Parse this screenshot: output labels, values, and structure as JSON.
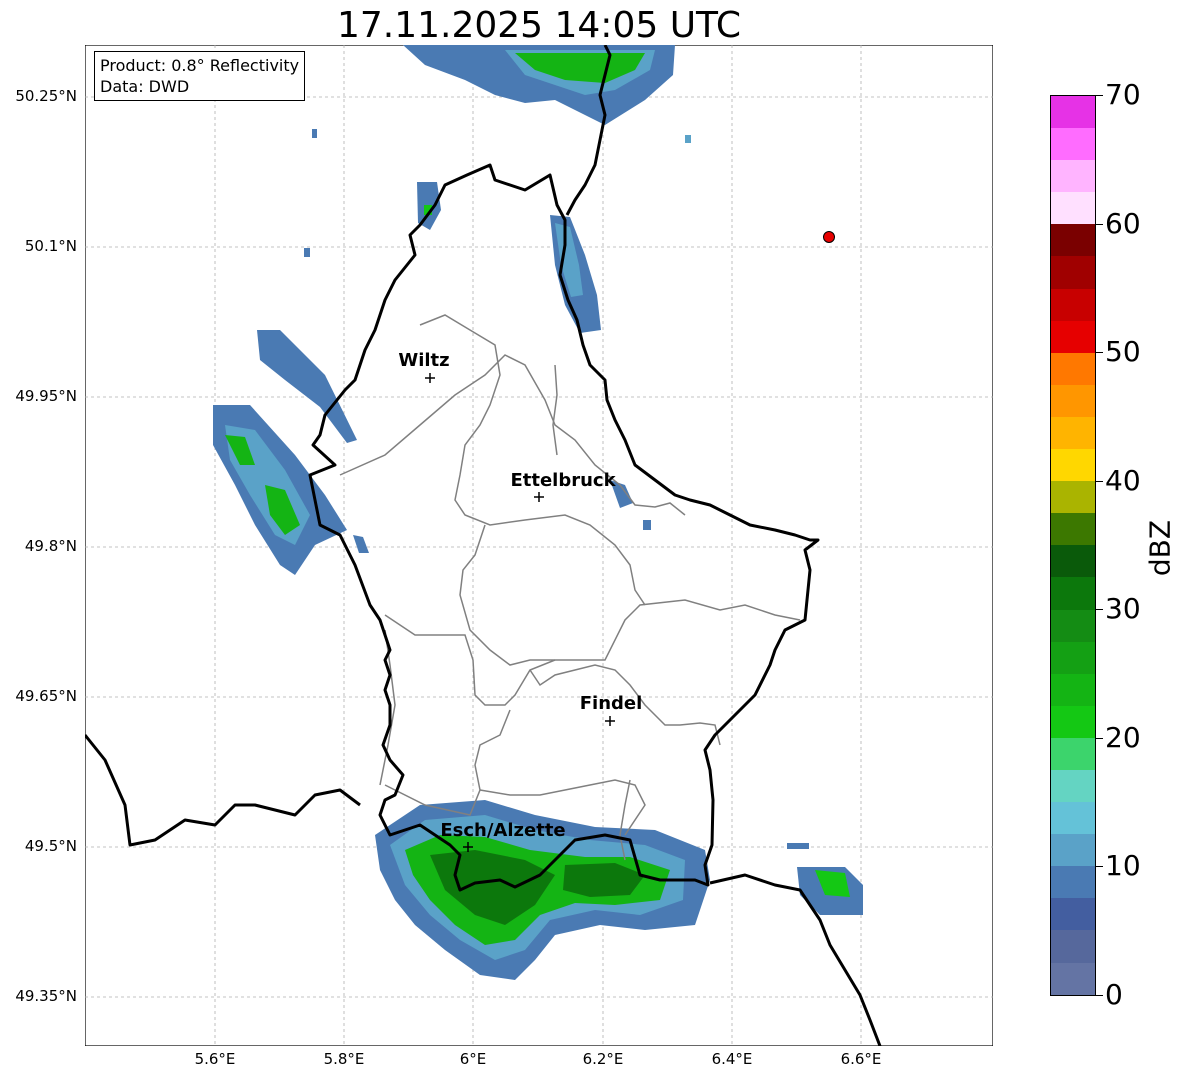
{
  "title": "17.11.2025 14:05 UTC",
  "info_box": {
    "line1": "Product: 0.8° Reflectivity",
    "line2": "Data: DWD"
  },
  "lat_labels": [
    "50.25°N",
    "50.1°N",
    "49.95°N",
    "49.8°N",
    "49.65°N",
    "49.5°N",
    "49.35°N"
  ],
  "lon_labels": [
    "5.6°E",
    "5.8°E",
    "6°E",
    "6.2°E",
    "6.4°E",
    "6.6°E"
  ],
  "cities": [
    {
      "name": "Wiltz",
      "lon": 5.93,
      "lat": 49.967
    },
    {
      "name": "Ettelbruck",
      "lon": 6.1,
      "lat": 49.848
    },
    {
      "name": "Findel",
      "lon": 6.21,
      "lat": 49.627
    },
    {
      "name": "Esch/Alzette",
      "lon": 5.99,
      "lat": 49.5
    }
  ],
  "radar_site": {
    "lon": 6.548,
    "lat": 50.11,
    "color": "#e60000"
  },
  "colorbar": {
    "label": "dBZ",
    "ticks": [
      "0",
      "10",
      "20",
      "30",
      "40",
      "50",
      "60",
      "70"
    ],
    "colors": [
      "#6474a4",
      "#56689c",
      "#435ea0",
      "#4a7ab3",
      "#5aa2c8",
      "#64c2d8",
      "#64d4c2",
      "#3cd46c",
      "#14c814",
      "#14b414",
      "#14a014",
      "#148c14",
      "#0c780c",
      "#0a5a0a",
      "#3c7800",
      "#aab400",
      "#ffd700",
      "#ffb400",
      "#ff9600",
      "#ff7800",
      "#e60000",
      "#c80000",
      "#a00000",
      "#7a0000",
      "#ffe0ff",
      "#ffb4ff",
      "#ff6cff",
      "#e632e6"
    ]
  }
}
